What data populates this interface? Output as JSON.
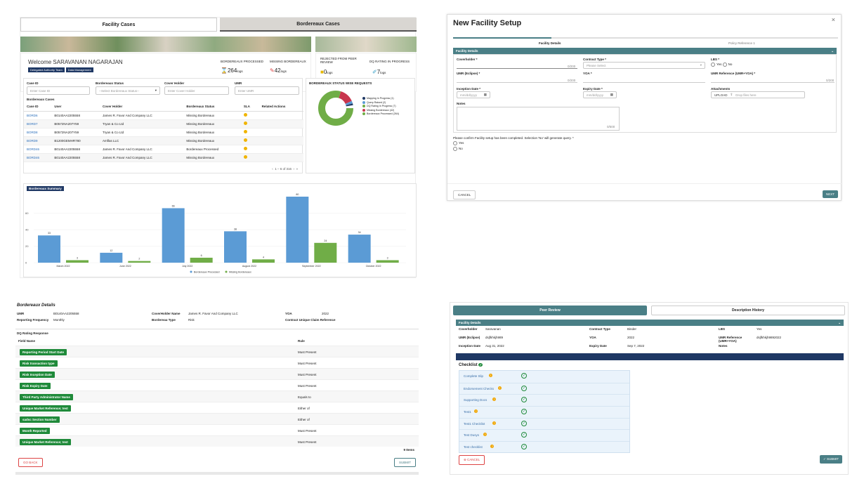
{
  "panel1": {
    "tabs": [
      "Facility Cases",
      "Bordereaux Cases"
    ],
    "welcome": "Welcome SARAVANAN NAGARAJAN",
    "roles": [
      "Delegated Authority Team",
      "Data Management"
    ],
    "stats": [
      {
        "label": "BORDEREAUX PROCESSED",
        "value": "264",
        "unit": "logs"
      },
      {
        "label": "MISSING BORDEREAUX",
        "value": "42",
        "unit": "logs"
      },
      {
        "label": "REJECTED FROM PEER REVIEW",
        "value": "0",
        "unit": "logs"
      },
      {
        "label": "DQ RATING IN PROGRESS",
        "value": "7",
        "unit": "logs"
      }
    ],
    "filters": {
      "case_id_label": "Case ID",
      "case_id_ph": "Enter Case ID",
      "status_label": "Bordereaux Status",
      "status_ph": "--Select Bordereaux Status--",
      "cover_label": "Cover Holder",
      "cover_ph": "Enter Cover Holder",
      "umr_label": "UMR",
      "umr_ph": "Enter UMR"
    },
    "table_title": "Bordereaux Cases",
    "headers": [
      "Case ID",
      "User",
      "Cover Holder",
      "Bordereaux Status",
      "SLA",
      "Related Actions"
    ],
    "rows": [
      [
        "BORD6",
        "B0140AA2205558",
        "James R. Favor And Company LLC",
        "Missing Bordereaux"
      ],
      [
        "BORD7",
        "B0572NA207Y59",
        "Tryan & Co Ltd",
        "Missing Bordereaux"
      ],
      [
        "BORD8",
        "B0572NA207Y59",
        "Tryan & Co Ltd",
        "Missing Bordereaux"
      ],
      [
        "BORD9",
        "B1200GEMHR780",
        "Amflas LLC",
        "Missing Bordereaux"
      ],
      [
        "BORD46",
        "B0140AA2205558",
        "James R. Favor And Company LLC",
        "Bordereaux Processed"
      ],
      [
        "BORD46",
        "B0140AA2205558",
        "James R. Favor And Company LLC",
        "Missing Bordereaux"
      ]
    ],
    "pagination": "1 – 6 of 316",
    "donut_title": "BORDEREAUX STATUS WISE REQUESTS",
    "donut_legend": [
      "Mapping In Progress (1)",
      "Query Raised (2)",
      "DQ Rating In Progress (7)",
      "Missing Bordereaux (42)",
      "Bordereaux Processed (264)"
    ],
    "colors": {
      "blue": "#5b9bd5",
      "green": "#70ad47",
      "red": "#c8364d",
      "gray": "#7f7f7f",
      "navy": "#1f3864"
    },
    "summary_title": "Bordereaux Summary",
    "legend": [
      "Bordereaux Processed",
      "Missing Bordereaux"
    ]
  },
  "chart_data": {
    "type": "bar",
    "title": "Bordereaux Summary",
    "categories": [
      "March 2022",
      "June 2022",
      "July 2022",
      "August 2022",
      "September 2022",
      "October 2022"
    ],
    "ylim": [
      0,
      60
    ],
    "yticks": [
      "0",
      "20",
      "40",
      "60"
    ],
    "series": [
      {
        "name": "Bordereaux Processed",
        "values": [
          33,
          12,
          66,
          38,
          80,
          34
        ]
      },
      {
        "name": "Missing Bordereaux",
        "values": [
          3,
          2,
          6,
          4,
          24,
          3
        ]
      }
    ]
  },
  "panel2": {
    "title": "New Facility Setup",
    "close": "×",
    "steps": [
      "Facility Details",
      "Policy Reference 1"
    ],
    "section": "Facility Details",
    "fields": {
      "coverholder": "Coverholder *",
      "count1": "0/200",
      "contract_type": "Contract Type *",
      "contract_ph": "Please Select",
      "lbs": "LBS *",
      "yes": "Yes",
      "no": "No",
      "umr": "UMR (Eclipse) *",
      "count2": "0/200",
      "yoa": "YOA *",
      "umr_ref": "UMR Reference (UMR+YOA) *",
      "count3": "0/200",
      "inception": "Inception Date *",
      "date_ph": "mm/dd/yyyy",
      "expiry": "Expiry Date *",
      "attachments": "Attachments",
      "upload": "UPLOAD",
      "drop": "Drop files here",
      "notes": "Notes",
      "count4": "0/500"
    },
    "confirm": "Please confirm Facility setup has been completed. Selection 'No' will generate query. *",
    "cancel": "CANCEL",
    "next": "NEXT"
  },
  "panel3": {
    "title": "Bordereaux Details",
    "umr_label": "UMR",
    "umr": "B0140AA2205558",
    "ch_label": "CoverHolder Name",
    "ch": "James R. Favor And Company LLC",
    "yoa_label": "YOA",
    "yoa": "2022",
    "freq_label": "Reporting Frequency",
    "freq": "Monthly",
    "type_label": "Bordereau Type",
    "type": "Risk",
    "contract_label": "Contract Unique Claim Reference",
    "dq_title": "DQ Rating Response",
    "col_field": "Field Name",
    "col_rule": "Rule",
    "rows": [
      [
        "Reporting Period Start Date",
        "Must Present"
      ],
      [
        "Risk transaction type",
        "Must Present"
      ],
      [
        "Risk Inception Date",
        "Must Present"
      ],
      [
        "Risk Expiry Date",
        "Must Present"
      ],
      [
        "Third Party Administrator Name",
        "Equals to"
      ],
      [
        "Unique Market Reference; test",
        "Either of"
      ],
      [
        "sadsc Section Number",
        "Either of"
      ],
      [
        "Month Reported",
        "Must Present"
      ],
      [
        "Unique Market Reference; test",
        "Must Present"
      ]
    ],
    "items": "9 Items",
    "back": "GO BACK",
    "submit": "SUBMIT"
  },
  "panel4": {
    "tabs": [
      "Peer Review",
      "Description History"
    ],
    "section": "Facility Details",
    "r1": [
      "Coverholder",
      "Saravanan",
      "Contract Type",
      "Binder",
      "LBS",
      "Yes"
    ],
    "r2": [
      "UMR (Eclipse)",
      "dsjfkhkjh989",
      "YOA",
      "2022",
      "UMR Reference (UMR+YOA)",
      "dsjfkhkjh9892022"
    ],
    "r3": [
      "Inception Date",
      "Aug 31, 2022",
      "Expiry Date",
      "Sep 7, 2022",
      "Notes",
      ""
    ],
    "checklist": "Checklist",
    "items": [
      "Complete Slip",
      "Endorsement Checks",
      "Supporting Docs",
      "Test1",
      "Test1 Checklist",
      "Test Dusys",
      "Test checklist"
    ],
    "cancel": "CANCEL",
    "submit": "SUBMIT"
  }
}
